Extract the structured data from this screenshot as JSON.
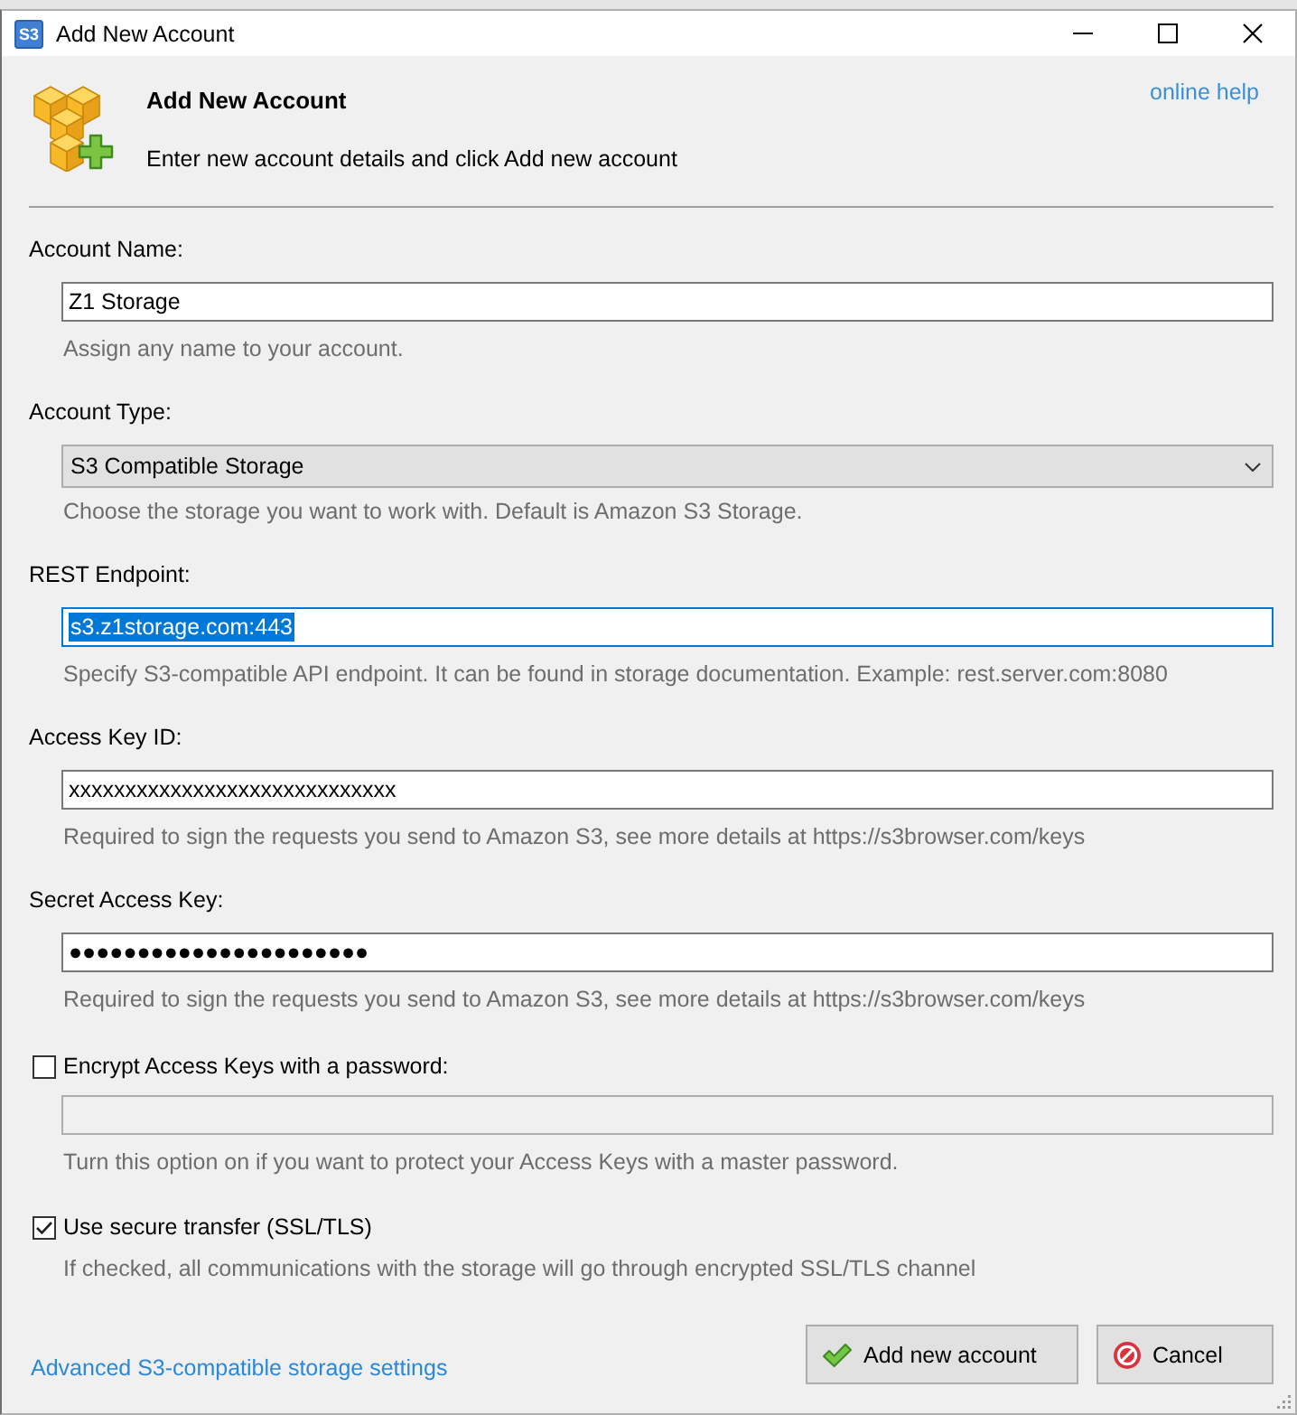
{
  "window": {
    "title": "Add New Account",
    "icon_label": "S3"
  },
  "header": {
    "title": "Add New Account",
    "subtitle": "Enter new account details and click Add new account",
    "help_link": "online help"
  },
  "fields": [
    {
      "kind": "text",
      "label": "Account Name:",
      "value": "Z1 Storage",
      "focused": false,
      "hint": "Assign any name to your account."
    },
    {
      "kind": "dropdown",
      "label": "Account Type:",
      "value": "S3 Compatible Storage",
      "hint": "Choose the storage you want to work with. Default is Amazon S3 Storage."
    },
    {
      "kind": "text",
      "label": "REST Endpoint:",
      "value": "s3.z1storage.com:443",
      "focused": true,
      "hint": "Specify S3-compatible API endpoint. It can be found in storage documentation. Example: rest.server.com:8080"
    },
    {
      "kind": "text",
      "label": "Access Key ID:",
      "value": "xxxxxxxxxxxxxxxxxxxxxxxxxxxxx",
      "focused": false,
      "hint": "Required to sign the requests you send to Amazon S3, see more details at https://s3browser.com/keys"
    },
    {
      "kind": "password",
      "label": "Secret Access Key:",
      "value": "●●●●●●●●●●●●●●●●●●●●●●",
      "focused": false,
      "hint": "Required to sign the requests you send to Amazon S3, see more details at https://s3browser.com/keys"
    },
    {
      "kind": "checkbox_field",
      "label": "Encrypt Access Keys with a password:",
      "checked": false,
      "disabled": true,
      "hint": "Turn this option on if you want to protect your Access Keys with a master password."
    },
    {
      "kind": "checkbox",
      "label": "Use secure transfer (SSL/TLS)",
      "checked": true,
      "hint": "If checked, all communications with the storage will go through encrypted SSL/TLS channel"
    }
  ],
  "footer": {
    "link": "Advanced S3-compatible storage settings",
    "buttons": [
      {
        "kind": "confirm",
        "label": "Add new account"
      },
      {
        "kind": "cancel",
        "label": "Cancel"
      }
    ]
  }
}
